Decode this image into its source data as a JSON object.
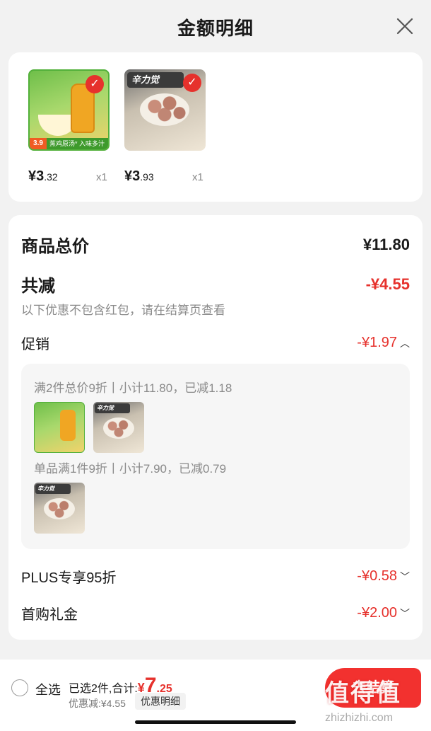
{
  "header": {
    "title": "金额明细"
  },
  "products": [
    {
      "price_symbol": "¥",
      "price_int": "3",
      "price_dec": ".32",
      "qty": "x1",
      "tag_price": "3.9",
      "tag_text": "蒸鸡原汤* 入味多汁",
      "icon": "soup-product-image"
    },
    {
      "price_symbol": "¥",
      "price_int": "3",
      "price_dec": ".93",
      "qty": "x1",
      "brand_text": "辛力觉",
      "icon": "meatball-product-image"
    }
  ],
  "summary": {
    "subtotal_label": "商品总价",
    "subtotal_value": "¥11.80",
    "reduction_label": "共减",
    "reduction_value": "-¥4.55",
    "note": "以下优惠不包含红包，请在结算页查看",
    "promo_label": "促销",
    "promo_value": "-¥1.97",
    "plus_label": "PLUS专享95折",
    "plus_value": "-¥0.58",
    "gift_label": "首购礼金",
    "gift_value": "-¥2.00"
  },
  "promos": [
    {
      "text": "满2件总价9折丨小计11.80，已减1.18"
    },
    {
      "text": "单品满1件9折丨小计7.90，已减0.79"
    }
  ],
  "bottom": {
    "select_all": "全选",
    "selected_text": "已选2件,合计:",
    "total_symbol": "¥",
    "total_int": "7",
    "total_dec": ".25",
    "discount_text": "优惠减:¥4.55",
    "detail_button": "优惠明细",
    "checkout_button": "去结算"
  },
  "watermark": {
    "logo": "值得值",
    "url": "zhizhizhi.com"
  },
  "colors": {
    "accent_red": "#e6312c",
    "background": "#f2f2f2"
  }
}
